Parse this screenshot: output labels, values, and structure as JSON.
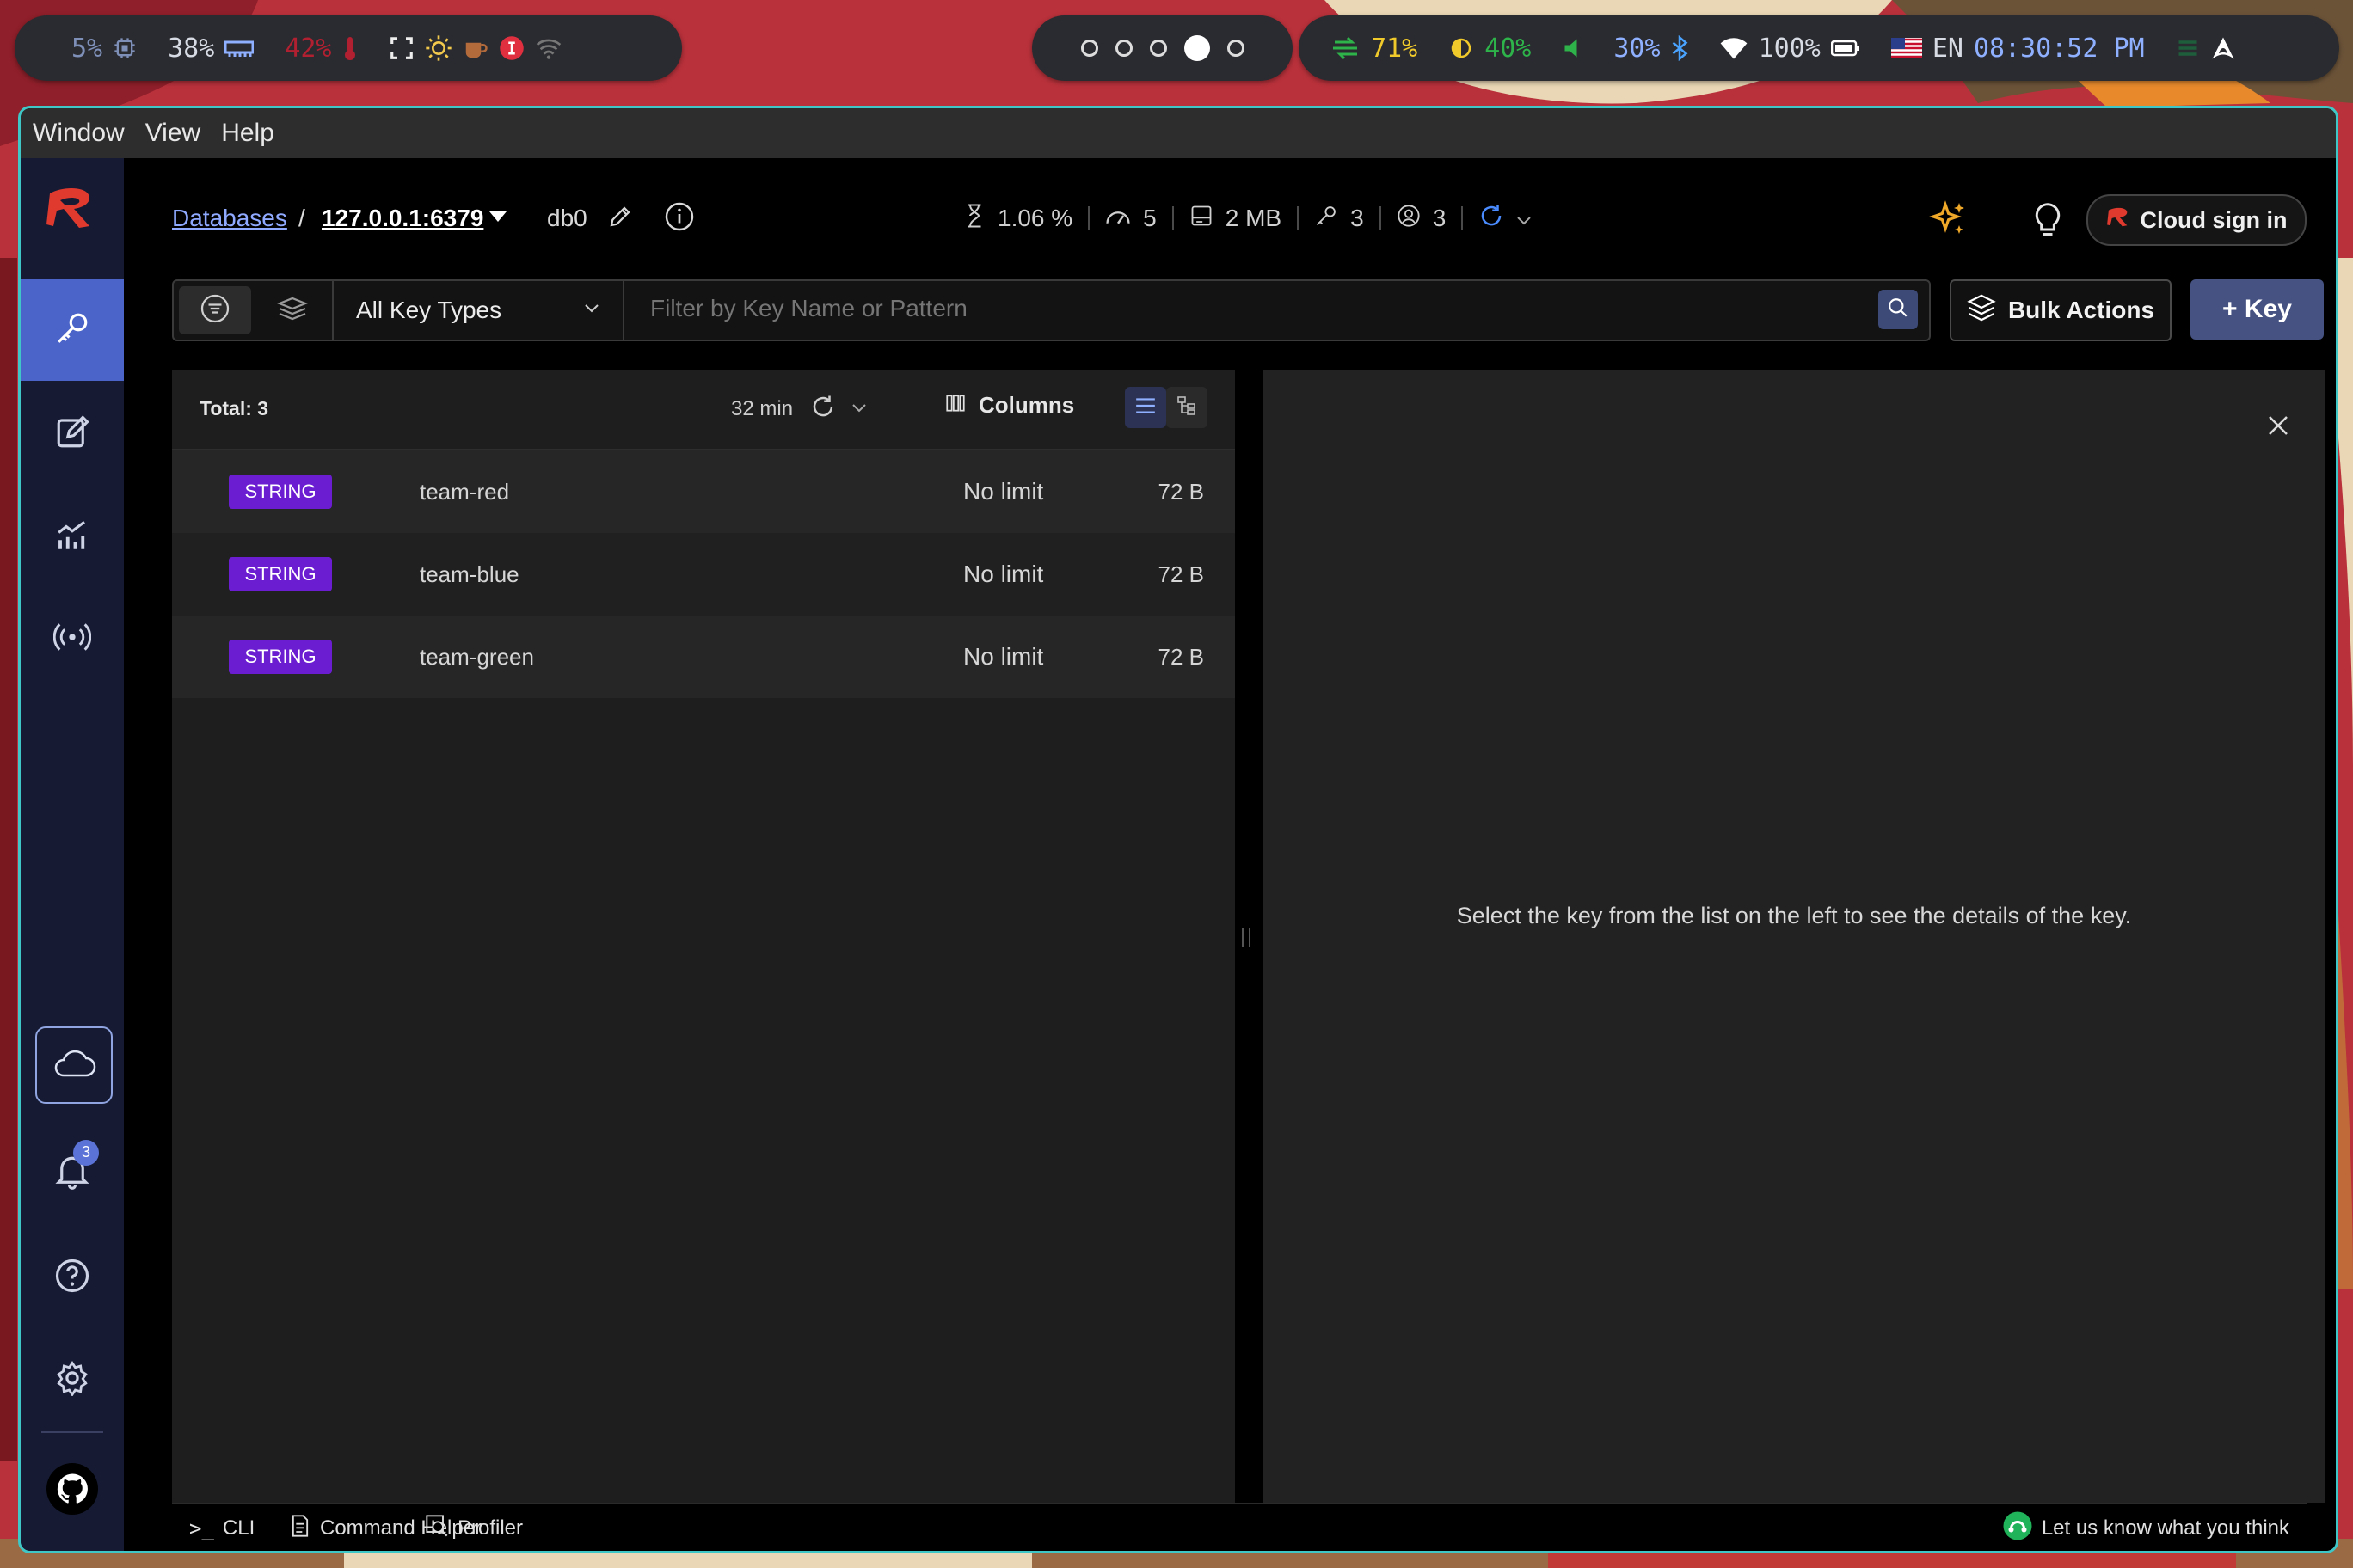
{
  "statusbar": {
    "left": {
      "cpu_percent": "5%",
      "memory_percent": "38%",
      "temp_percent": "42%",
      "colors": {
        "ok": "#7e8fb8",
        "warn": "#b02030"
      }
    },
    "workspaces": {
      "count": 5,
      "active_index": 3
    },
    "right": {
      "net_percent": "71%",
      "brightness_percent": "40%",
      "volume_percent": "30%",
      "battery_percent": "100%",
      "language": "EN",
      "clock": "08:30:52 PM"
    }
  },
  "app": {
    "menu": [
      "Window",
      "View",
      "Help"
    ],
    "colors": {
      "accent": "#4b64c9",
      "string_tag": "#6a1dd1",
      "logo": "#e03a2f"
    }
  },
  "header": {
    "breadcrumb_root": "Databases",
    "breadcrumb_sep": "/",
    "host": "127.0.0.1:6379",
    "db": "db0",
    "stats": {
      "cpu": "1.06 %",
      "ops": "5",
      "memory": "2 MB",
      "keys": "3",
      "clients": "3"
    },
    "cloud_button": "Cloud sign in"
  },
  "filter": {
    "key_type": "All Key Types",
    "search_placeholder": "Filter by Key Name or Pattern",
    "bulk_actions": "Bulk Actions",
    "add_key": "+ Key"
  },
  "list": {
    "total": "Total: 3",
    "refresh_age": "32 min",
    "columns_label": "Columns",
    "rows": [
      {
        "type": "STRING",
        "name": "team-red",
        "ttl": "No limit",
        "size": "72 B"
      },
      {
        "type": "STRING",
        "name": "team-blue",
        "ttl": "No limit",
        "size": "72 B"
      },
      {
        "type": "STRING",
        "name": "team-green",
        "ttl": "No limit",
        "size": "72 B"
      }
    ]
  },
  "detail": {
    "empty_message": "Select the key from the list on the left to see the details of the key."
  },
  "sidebar": {
    "notifications_count": "3"
  },
  "bottom": {
    "cli": "CLI",
    "cli_prompt": ">_",
    "command_helper": "Command Helper",
    "profiler": "Profiler",
    "feedback": "Let us know what you think"
  }
}
